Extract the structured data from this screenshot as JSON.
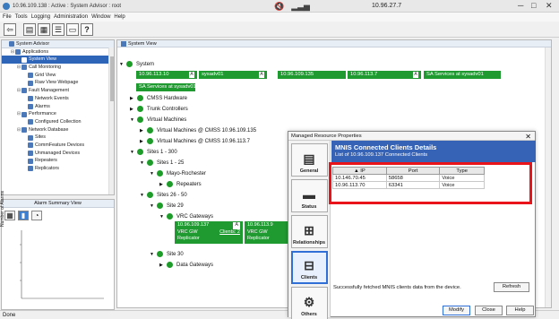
{
  "window": {
    "title": "10.96.109.138 : Active : System Advisor : root",
    "remote_address": "10.96.27.7"
  },
  "menu": [
    "File",
    "Tools",
    "Logging",
    "Administration",
    "Window",
    "Help"
  ],
  "toolbar": {
    "buttons": [
      "back-icon",
      "save-icon",
      "grid-icon",
      "table-icon",
      "window-icon",
      "help-icon"
    ]
  },
  "left_tree": {
    "title": "System Advisor",
    "items": [
      {
        "label": "System Advisor",
        "indent": 0
      },
      {
        "label": "Applications",
        "indent": 1
      },
      {
        "label": "System View",
        "indent": 2,
        "selected": true
      },
      {
        "label": "Call Monitoring",
        "indent": 2
      },
      {
        "label": "Grid View",
        "indent": 3
      },
      {
        "label": "Raw View Webpage",
        "indent": 3
      },
      {
        "label": "Fault Management",
        "indent": 2
      },
      {
        "label": "Network Events",
        "indent": 3
      },
      {
        "label": "Alarms",
        "indent": 3
      },
      {
        "label": "Performance",
        "indent": 2
      },
      {
        "label": "Configured Collection",
        "indent": 3
      },
      {
        "label": "Network Database",
        "indent": 2
      },
      {
        "label": "Sites",
        "indent": 3
      },
      {
        "label": "CommFeature Devices",
        "indent": 3
      },
      {
        "label": "Unmanaged Devices",
        "indent": 3
      },
      {
        "label": "Repeaters",
        "indent": 3
      },
      {
        "label": "Replicators",
        "indent": 3
      }
    ]
  },
  "alarm_summary": {
    "title": "Alarm Summary View",
    "y_label": "Number of Alarms"
  },
  "status_bar": "Done",
  "system_view": {
    "title": "System View",
    "root": "System",
    "ip_row": [
      {
        "label": "10.96.113.10",
        "badge": "A"
      },
      {
        "label": "sysadv01",
        "badge": "A"
      },
      {
        "label": "10.96.109.135",
        "badge": ""
      },
      {
        "label": "10.96.113.7",
        "badge": "A"
      },
      {
        "label": "SA Services at sysadv01",
        "badge": ""
      }
    ],
    "sa_services": "SA Services at sysadv01",
    "nodes": {
      "cmss_hardware": "CMSS Hardware",
      "trunk_controllers": "Trunk Controllers",
      "virtual_machines": "Virtual Machines",
      "vm1": "Virtual Machines @ CMSS 10.96.109.135",
      "vm2": "Virtual Machines @ CMSS 10.96.113.7",
      "sites_1_300": "Sites 1 - 300",
      "sites_1_25": "Sites 1 - 25",
      "mayo": "Mayo-Rochester",
      "repeaters": "Repeaters",
      "sites_26_50": "Sites 26 - 50",
      "site_29": "Site 29",
      "vrc_gateways": "VRC Gateways",
      "site_30": "Site 30",
      "data_gateways": "Data Gateways"
    },
    "gateways": [
      {
        "ip": "10.96.109.137",
        "badge": "A",
        "type": "VRC GW",
        "clients": "Clients: 2",
        "replicator": "Replicator"
      },
      {
        "ip": "10.96.113.9",
        "badge": "",
        "type": "VRC GW",
        "clients": "",
        "replicator": "Replicator"
      }
    ]
  },
  "dialog": {
    "title": "Managed Resource Properties",
    "close_label": "✕",
    "tabs": [
      {
        "label": "General",
        "icon": "document-icon"
      },
      {
        "label": "Status",
        "icon": "status-icon"
      },
      {
        "label": "Relationships",
        "icon": "relationships-icon"
      },
      {
        "label": "Clients",
        "icon": "clients-icon",
        "active": true
      },
      {
        "label": "Others",
        "icon": "others-icon"
      }
    ],
    "heading": "MNIS Connected Clients Details",
    "subheading": "List of 10.96.109.137 Connected Clients",
    "columns": [
      "▲ IP",
      "Port",
      "Type"
    ],
    "rows": [
      [
        "10.146.70.45",
        "58658",
        "Voice"
      ],
      [
        "10.96.113.70",
        "63341",
        "Voice"
      ]
    ],
    "message": "Successfully fetched MNIS clients data from the device.",
    "refresh": "Refresh",
    "modify": "Modify",
    "close": "Close",
    "help": "Help",
    "highlight_color": "#e8141a"
  },
  "colors": {
    "node_green": "#1e9c2a",
    "accent_blue": "#3663b5"
  }
}
